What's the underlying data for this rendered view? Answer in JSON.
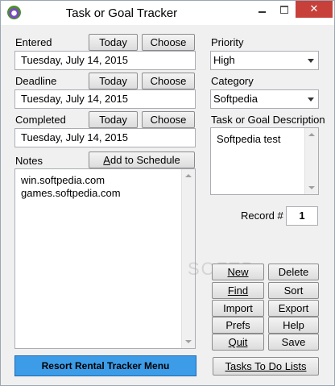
{
  "window": {
    "title": "Task or Goal Tracker",
    "close_glyph": "✕"
  },
  "entered": {
    "label": "Entered",
    "today": "Today",
    "choose": "Choose",
    "value": "Tuesday, July 14, 2015"
  },
  "deadline": {
    "label": "Deadline",
    "today": "Today",
    "choose": "Choose",
    "value": "Tuesday, July 14, 2015"
  },
  "completed": {
    "label": "Completed",
    "today": "Today",
    "choose": "Choose",
    "value": "Tuesday, July 14, 2015"
  },
  "notes": {
    "label": "Notes",
    "add_button": "Add to Schedule",
    "lines": [
      "win.softpedia.com",
      "games.softpedia.com"
    ]
  },
  "priority": {
    "label": "Priority",
    "value": "High"
  },
  "category": {
    "label": "Category",
    "value": "Softpedia"
  },
  "description": {
    "label": "Task or Goal Description",
    "value": "Softpedia test"
  },
  "record": {
    "label": "Record #",
    "value": "1"
  },
  "actions": {
    "new": "New",
    "delete": "Delete",
    "find": "Find",
    "sort": "Sort",
    "import": "Import",
    "export": "Export",
    "prefs": "Prefs",
    "help": "Help",
    "quit": "Quit",
    "save": "Save"
  },
  "footer": {
    "resort_menu": "Resort Rental Tracker Menu",
    "tasks_lists": "Tasks To Do Lists"
  },
  "colors": {
    "accent_button": "#3d9ce8",
    "close_button": "#c7403a"
  }
}
